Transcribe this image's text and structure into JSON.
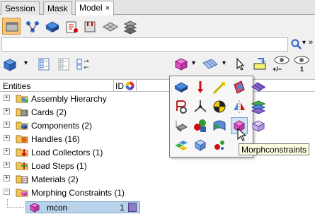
{
  "tabs": [
    {
      "label": "Session"
    },
    {
      "label": "Mask"
    },
    {
      "label": "Model",
      "close": "×"
    }
  ],
  "search_row": {
    "dropdown": "▾",
    "more": "»"
  },
  "toolbar2": {
    "count_label": "+/−",
    "view_number": "1"
  },
  "table": {
    "col_entities": "Entities",
    "col_id": "ID"
  },
  "tree": [
    {
      "label": "Assembly Hierarchy"
    },
    {
      "label": "Cards (2)"
    },
    {
      "label": "Components (2)"
    },
    {
      "label": "Handles (16)"
    },
    {
      "label": "Load Collectors (1)"
    },
    {
      "label": "Load Steps (1)"
    },
    {
      "label": "Materials (2)"
    },
    {
      "label": "Morphing Constraints (1)"
    }
  ],
  "child": {
    "label": "mcon",
    "id": "1",
    "swatch_color": "#8e7cc3"
  },
  "tooltip": "Morphconstraints",
  "colors": {
    "selected_tab_bg": "#ffffff",
    "highlight_row": "#b8d2ea",
    "tooltip_bg": "#ffffe1"
  }
}
